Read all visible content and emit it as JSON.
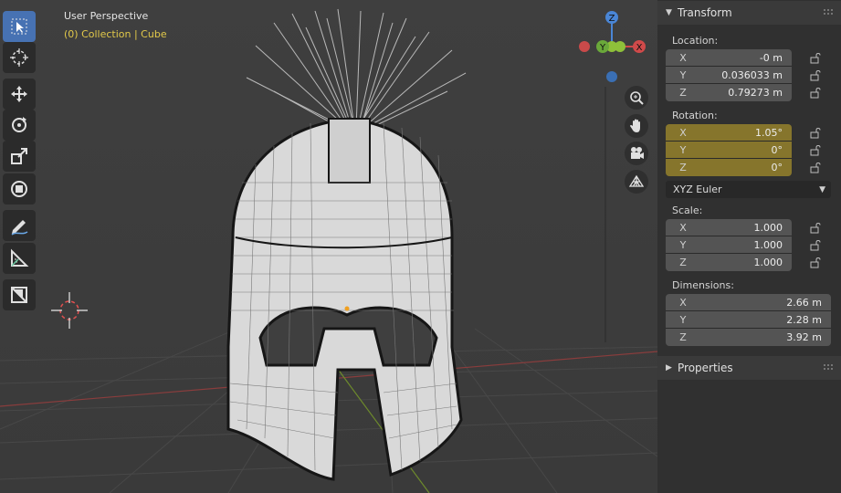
{
  "viewport": {
    "title": "User Perspective",
    "subtitle": "(0) Collection | Cube",
    "gizmo": {
      "z": "Z",
      "y": "Y",
      "x": "X"
    }
  },
  "toolbar": {
    "tools": [
      "select-box-icon",
      "cursor-icon",
      "move-icon",
      "rotate-icon",
      "scale-icon",
      "transform-icon",
      "annotate-icon",
      "measure-icon",
      "add-cube-icon"
    ]
  },
  "navigation": [
    "zoom-icon",
    "hand-pan-icon",
    "camera-icon",
    "grid-ortho-icon"
  ],
  "transform": {
    "header": "Transform",
    "location_label": "Location:",
    "location": [
      {
        "axis": "X",
        "value": "-0 m"
      },
      {
        "axis": "Y",
        "value": "0.036033 m"
      },
      {
        "axis": "Z",
        "value": "0.79273 m"
      }
    ],
    "rotation_label": "Rotation:",
    "rotation": [
      {
        "axis": "X",
        "value": "1.05°"
      },
      {
        "axis": "Y",
        "value": "0°"
      },
      {
        "axis": "Z",
        "value": "0°"
      }
    ],
    "rotation_mode": "XYZ Euler",
    "scale_label": "Scale:",
    "scale": [
      {
        "axis": "X",
        "value": "1.000"
      },
      {
        "axis": "Y",
        "value": "1.000"
      },
      {
        "axis": "Z",
        "value": "1.000"
      }
    ],
    "dimensions_label": "Dimensions:",
    "dimensions": [
      {
        "axis": "X",
        "value": "2.66 m"
      },
      {
        "axis": "Y",
        "value": "2.28 m"
      },
      {
        "axis": "Z",
        "value": "3.92 m"
      }
    ]
  },
  "properties_header": "Properties",
  "colors": {
    "accent": "#4772b3",
    "keyframed": "#86752c",
    "selected_text": "#e2c94a"
  }
}
